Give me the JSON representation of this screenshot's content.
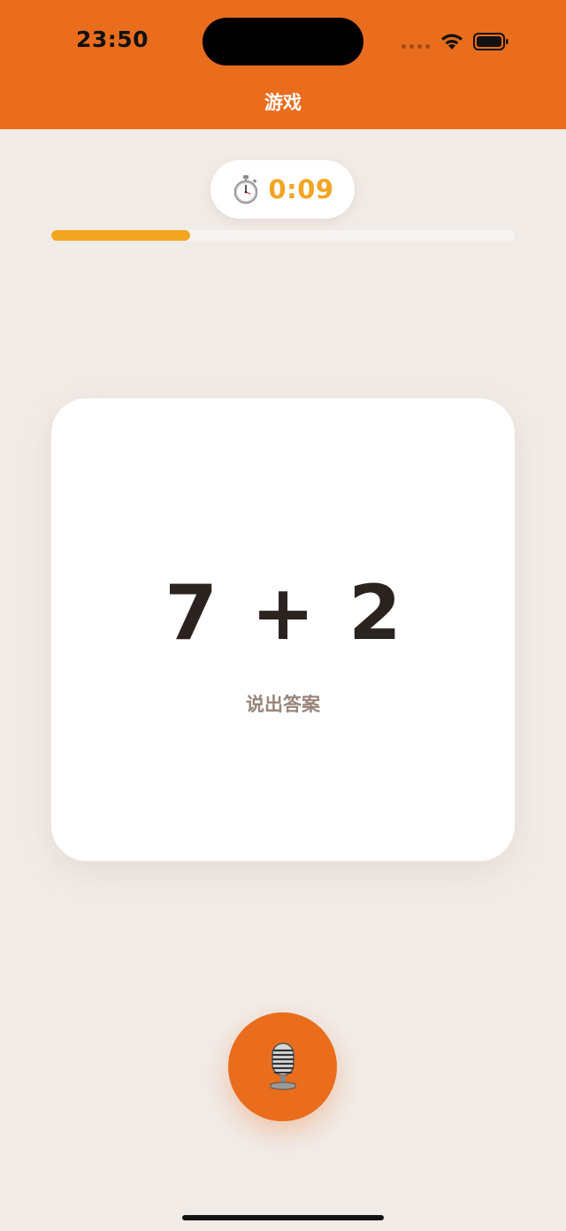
{
  "status_bar": {
    "time": "23:50"
  },
  "nav": {
    "title": "游戏"
  },
  "timer": {
    "icon": "stopwatch-icon",
    "value": "0:09"
  },
  "progress": {
    "fraction": 0.3
  },
  "question": {
    "equation": "7 + 2",
    "hint": "说出答案"
  },
  "mic": {
    "icon": "microphone-icon"
  },
  "colors": {
    "accent": "#e96d1d",
    "timer": "#f2a423",
    "background": "#f1ebe7"
  }
}
